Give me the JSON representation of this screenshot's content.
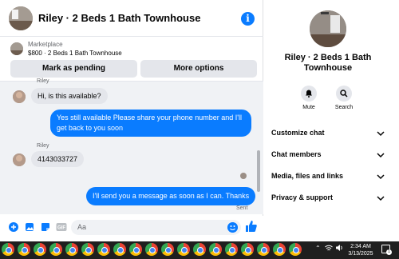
{
  "header": {
    "title": "Riley · 2 Beds 1 Bath Townhouse",
    "info_icon": "info-icon"
  },
  "marketplace": {
    "label": "Marketplace",
    "listing": "$800 · 2 Beds 1 Bath Townhouse",
    "pending_button": "Mark as pending",
    "options_button": "More options"
  },
  "messages": {
    "top_sender_partial": "Riley",
    "m1": "Hi, is this available?",
    "m2": "Yes still available Please share your phone number and I'll get back to you soon",
    "sender2": "Riley",
    "m3": "4143033727",
    "m4": "I'll send you a message as soon as I can. Thanks",
    "sent_status": "Sent"
  },
  "composer": {
    "placeholder": "Aa",
    "icons": [
      "plus-circle-icon",
      "photo-icon",
      "sticker-icon",
      "gif-icon",
      "emoji-icon",
      "like-icon"
    ]
  },
  "info_panel": {
    "title": "Riley · 2 Beds 1 Bath Townhouse",
    "mute_label": "Mute",
    "search_label": "Search",
    "sections": [
      "Customize chat",
      "Chat members",
      "Media, files and links",
      "Privacy & support"
    ]
  },
  "taskbar": {
    "time": "2:34 AM",
    "date": "3/13/2025",
    "notif_count": "1"
  },
  "colors": {
    "accent": "#0a7cff",
    "bubble_in": "#e4e6eb",
    "chat_bg": "#f0f2f5",
    "taskbar": "#1f1f1f"
  }
}
